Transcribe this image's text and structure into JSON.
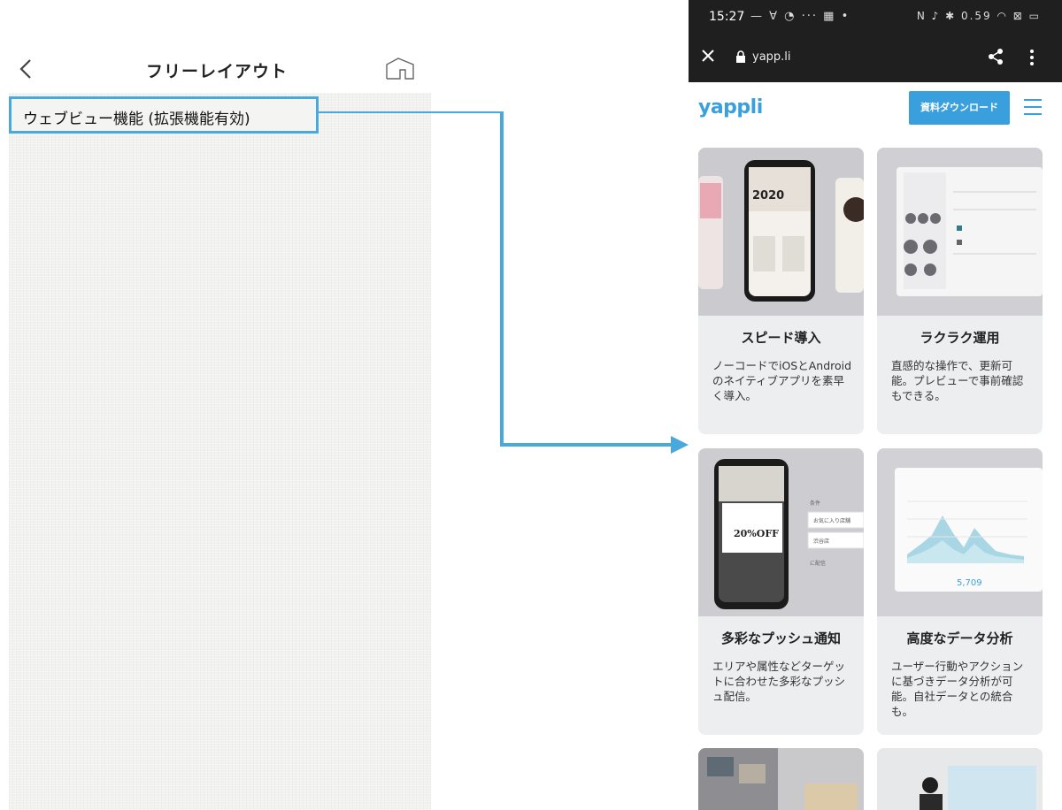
{
  "left_panel": {
    "title": "フリーレイアウト",
    "webview_label": "ウェブビュー機能 (拡張機能有効)"
  },
  "status_bar": {
    "time": "15:27",
    "left_icons": "— ∀ ◔ ··· ▦ •",
    "right_icons": "N ♪ ✱ 0.59 ◠ ⊠ ▭"
  },
  "browser": {
    "url": "yapp.li"
  },
  "site": {
    "logo": "yappli",
    "download_label": "資料ダウンロード"
  },
  "cards": [
    {
      "title": "スピード導入",
      "desc": "ノーコードでiOSとAndroidのネイティブアプリを素早く導入。",
      "image_text": "2020"
    },
    {
      "title": "ラクラク運用",
      "desc": "直感的な操作で、更新可能。プレビューで事前確認もできる。"
    },
    {
      "title": "多彩なプッシュ通知",
      "desc": "エリアや属性などターゲットに合わせた多彩なプッシュ配信。",
      "image_text": "20%OFF",
      "tags": [
        "条件",
        "お気に入り店舗",
        "渋谷店",
        "に配信"
      ]
    },
    {
      "title": "高度なデータ分析",
      "desc": "ユーザー行動やアクションに基づきデータ分析が可能。自社データとの統合も。",
      "image_text": "5,709"
    }
  ],
  "colors": {
    "accent": "#3aa0dd",
    "highlight_border": "#49a9dc",
    "card_bg": "#eceef0",
    "status_bar": "#1f1f1f"
  }
}
